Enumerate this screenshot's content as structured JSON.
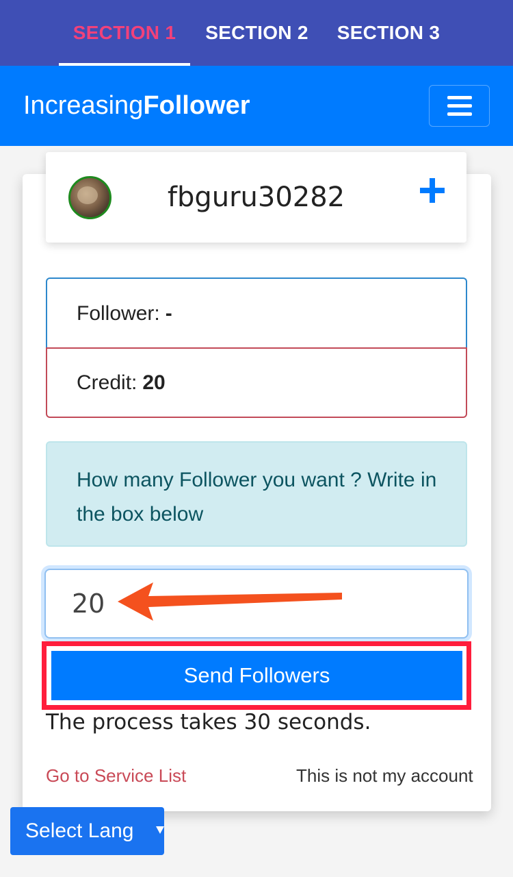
{
  "tabs": [
    {
      "label": "SECTION 1",
      "active": true
    },
    {
      "label": "SECTION 2",
      "active": false
    },
    {
      "label": "SECTION 3",
      "active": false
    }
  ],
  "navbar": {
    "brand_regular": "Increasing",
    "brand_bold": "Follower",
    "menu_icon": "hamburger-icon"
  },
  "user": {
    "username": "fbguru30282",
    "add_icon": "plus-icon"
  },
  "stats": {
    "follower_label": "Follower:",
    "follower_value": "-",
    "credit_label": "Credit:",
    "credit_value": "20"
  },
  "info": {
    "message": "How many Follower you want ? Write in the box below"
  },
  "form": {
    "quantity_value": "20",
    "send_label": "Send Followers",
    "process_note": "The process takes 30 seconds."
  },
  "links": {
    "service_list": "Go to Service List",
    "not_my_account": "This is not my account"
  },
  "language": {
    "selected": "Select Language"
  },
  "colors": {
    "tab_bar": "#3f4fb5",
    "tab_active": "#f2417a",
    "navbar": "#007bff",
    "highlight_frame": "#ff1e3c",
    "arrow": "#f4511e"
  }
}
